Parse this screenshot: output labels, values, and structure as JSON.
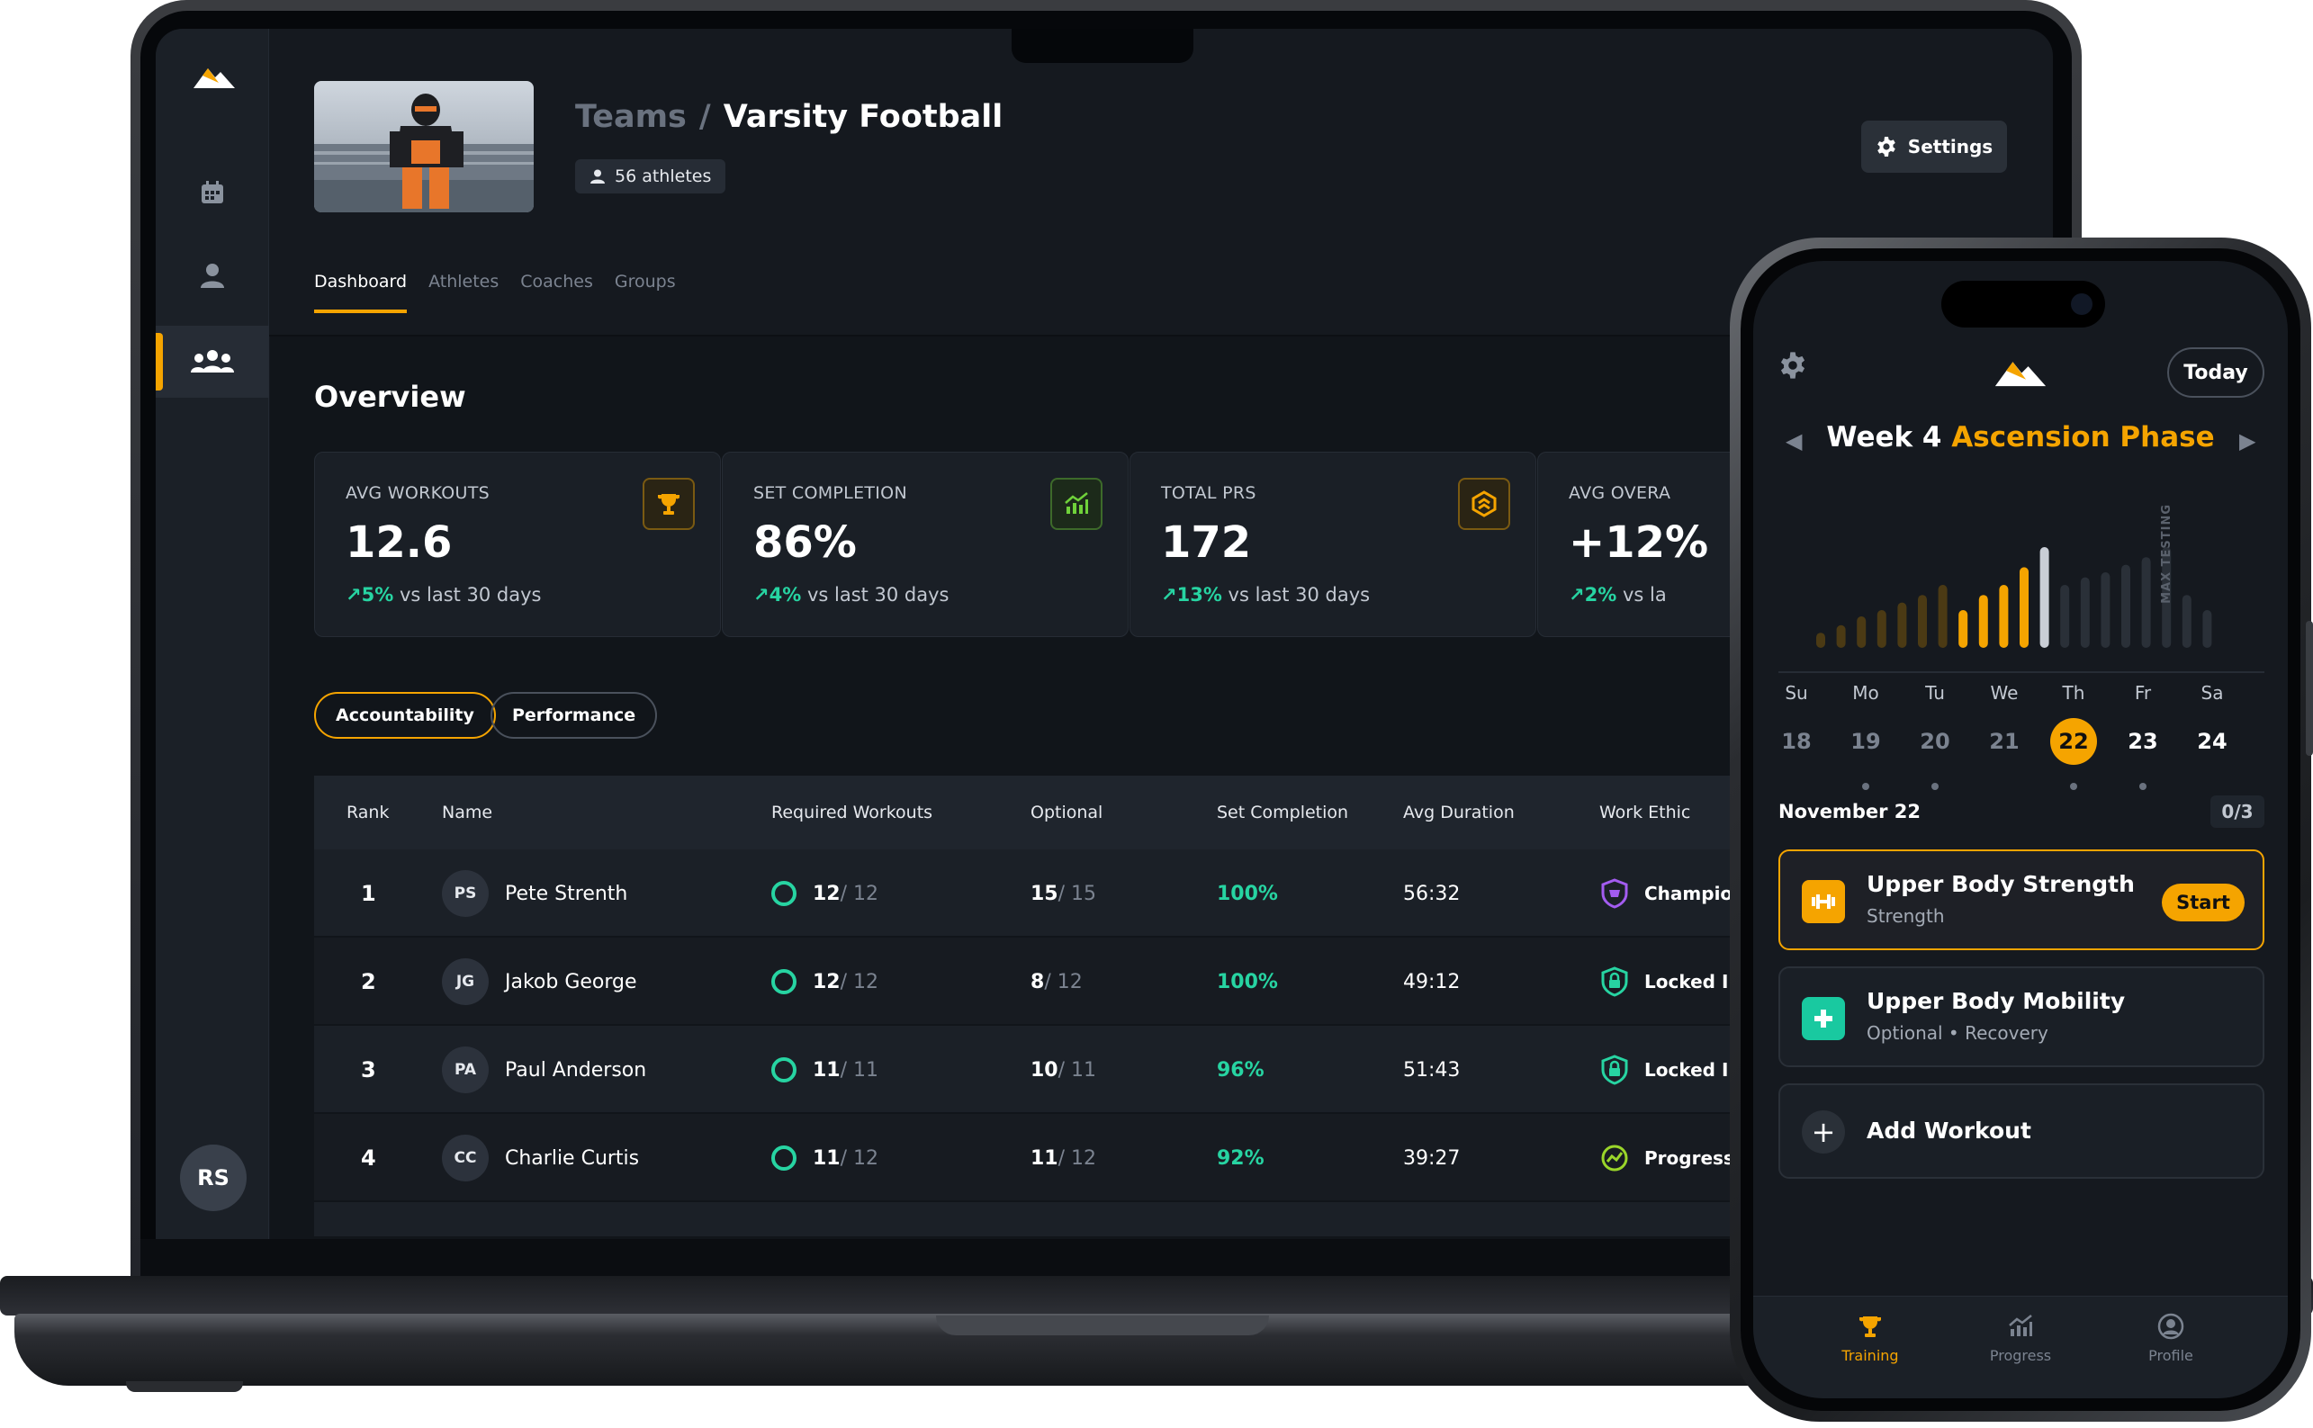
{
  "sidebar": {
    "avatar_initials": "RS"
  },
  "header": {
    "crumb_parent": "Teams",
    "crumb_separator": "/",
    "crumb_current": "Varsity Football",
    "athletes_label": "56 athletes",
    "settings_label": "Settings"
  },
  "tabs": [
    {
      "label": "Dashboard"
    },
    {
      "label": "Athletes"
    },
    {
      "label": "Coaches"
    },
    {
      "label": "Groups"
    }
  ],
  "overview": {
    "title": "Overview",
    "stats": [
      {
        "label": "AVG WORKOUTS",
        "value": "12.6",
        "delta": "5%",
        "delta_text": " vs last 30 days"
      },
      {
        "label": "SET COMPLETION",
        "value": "86%",
        "delta": "4%",
        "delta_text": " vs last 30 days"
      },
      {
        "label": "TOTAL PRS",
        "value": "172",
        "delta": "13%",
        "delta_text": " vs last 30 days"
      },
      {
        "label": "AVG OVERA",
        "value": "+12%",
        "delta": "2%",
        "delta_text": " vs la"
      }
    ]
  },
  "filters": {
    "accountability": "Accountability",
    "performance": "Performance"
  },
  "table": {
    "headers": {
      "rank": "Rank",
      "name": "Name",
      "required": "Required Workouts",
      "optional": "Optional",
      "set_completion": "Set Completion",
      "avg_duration": "Avg Duration",
      "work_ethic": "Work Ethic"
    },
    "rows": [
      {
        "rank": "1",
        "initials": "PS",
        "name": "Pete Strenth",
        "req_done": "12",
        "req_total": " / 12",
        "opt_done": "15",
        "opt_total": " / 15",
        "completion": "100%",
        "duration": "56:32",
        "ethic": "Champion"
      },
      {
        "rank": "2",
        "initials": "JG",
        "name": "Jakob George",
        "req_done": "12",
        "req_total": " / 12",
        "opt_done": "8",
        "opt_total": " / 12",
        "completion": "100%",
        "duration": "49:12",
        "ethic": "Locked In"
      },
      {
        "rank": "3",
        "initials": "PA",
        "name": "Paul Anderson",
        "req_done": "11",
        "req_total": " / 11",
        "opt_done": "10",
        "opt_total": " / 11",
        "completion": "96%",
        "duration": "51:43",
        "ethic": "Locked In"
      },
      {
        "rank": "4",
        "initials": "CC",
        "name": "Charlie Curtis",
        "req_done": "11",
        "req_total": " / 12",
        "opt_done": "11",
        "opt_total": " / 12",
        "completion": "92%",
        "duration": "39:27",
        "ethic": "Progressing"
      }
    ]
  },
  "phone": {
    "today_label": "Today",
    "week_label": "Week 4",
    "phase_label": "Ascension Phase",
    "max_testing_label": "MAX TESTING",
    "weekdays": [
      "Su",
      "Mo",
      "Tu",
      "We",
      "Th",
      "Fr",
      "Sa"
    ],
    "dates": [
      "18",
      "19",
      "20",
      "21",
      "22",
      "23",
      "24"
    ],
    "date_heading": "November 22",
    "progress_count": "0/3",
    "workouts": [
      {
        "title": "Upper Body Strength",
        "subtitle": "Strength",
        "action": "Start"
      },
      {
        "title": "Upper Body Mobility",
        "subtitle": "Optional • Recovery"
      }
    ],
    "add_workout_label": "Add Workout",
    "nav": [
      {
        "label": "Training"
      },
      {
        "label": "Progress"
      },
      {
        "label": "Profile"
      }
    ],
    "week_bars": [
      0.12,
      0.18,
      0.25,
      0.3,
      0.36,
      0.42,
      0.5,
      0.3,
      0.42,
      0.5,
      0.64,
      0.8,
      0.5,
      0.56,
      0.6,
      0.66,
      0.72,
      0.8,
      0.42,
      0.3
    ],
    "accent_color": "#f5a400",
    "success_color": "#27d4a2"
  }
}
